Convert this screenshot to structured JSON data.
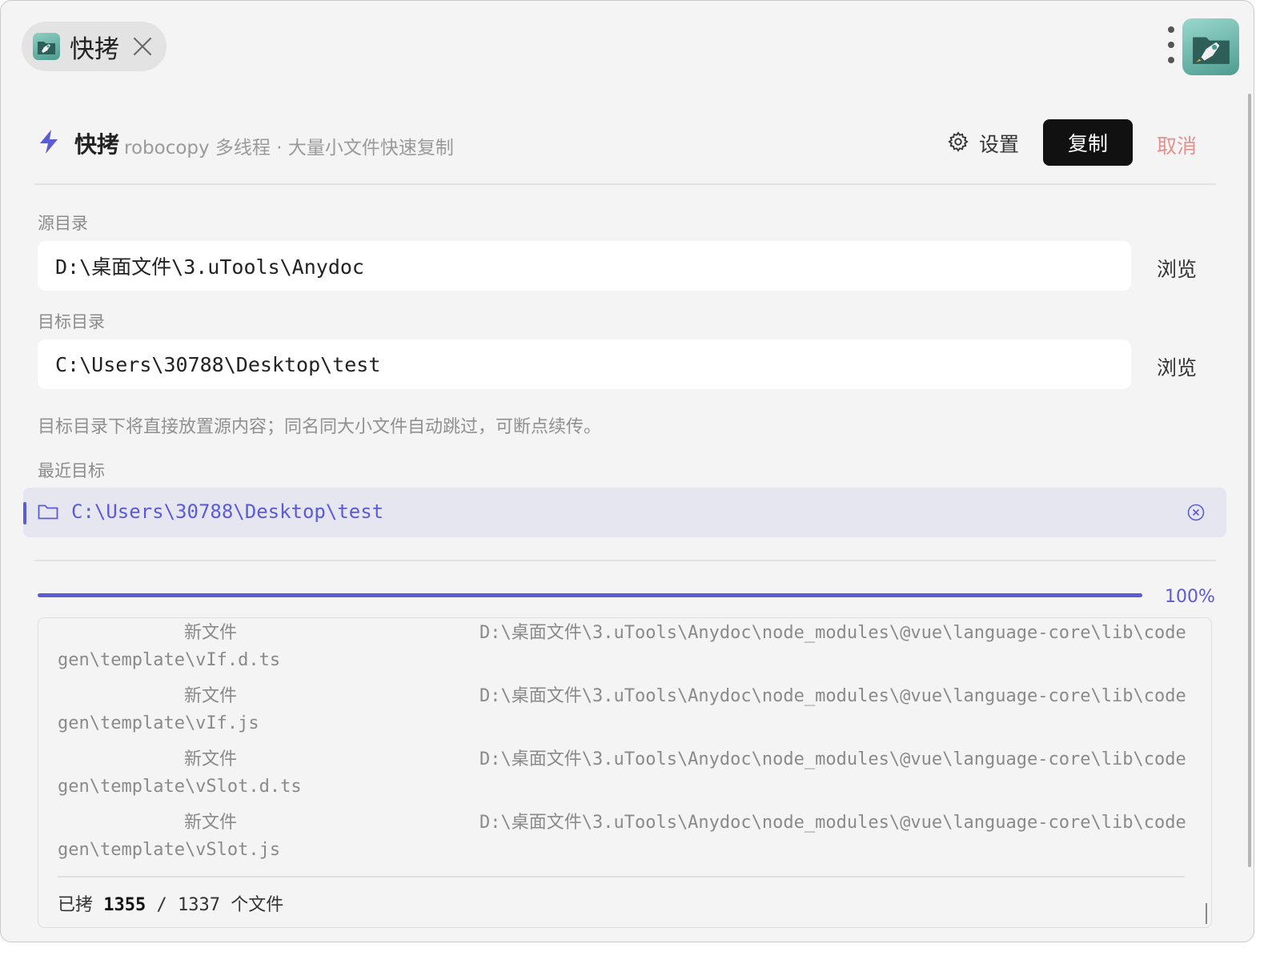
{
  "tab": {
    "title": "快拷"
  },
  "header": {
    "title": "快拷",
    "subtitle": "robocopy 多线程 · 大量小文件快速复制",
    "settings_label": "设置",
    "copy_label": "复制",
    "cancel_label": "取消"
  },
  "source": {
    "label": "源目录",
    "value": "D:\\桌面文件\\3.uTools\\Anydoc",
    "browse_label": "浏览"
  },
  "target": {
    "label": "目标目录",
    "value": "C:\\Users\\30788\\Desktop\\test",
    "browse_label": "浏览"
  },
  "hint": "目标目录下将直接放置源内容；同名同大小文件自动跳过，可断点续传。",
  "recent": {
    "label": "最近目标",
    "items": [
      {
        "path": "C:\\Users\\30788\\Desktop\\test"
      }
    ]
  },
  "progress": {
    "percent": 100,
    "label": "100%"
  },
  "log": {
    "entries": [
      {
        "status": "新文件",
        "path_line1": "D:\\桌面文件\\3.uTools\\Anydoc\\node_modules\\@vue\\language-core\\lib\\code",
        "path_line2": "gen\\template\\vIf.d.ts"
      },
      {
        "status": "新文件",
        "path_line1": "D:\\桌面文件\\3.uTools\\Anydoc\\node_modules\\@vue\\language-core\\lib\\code",
        "path_line2": "gen\\template\\vIf.js"
      },
      {
        "status": "新文件",
        "path_line1": "D:\\桌面文件\\3.uTools\\Anydoc\\node_modules\\@vue\\language-core\\lib\\code",
        "path_line2": "gen\\template\\vSlot.d.ts"
      },
      {
        "status": "新文件",
        "path_line1": "D:\\桌面文件\\3.uTools\\Anydoc\\node_modules\\@vue\\language-core\\lib\\code",
        "path_line2": "gen\\template\\vSlot.js"
      }
    ],
    "summary": {
      "prefix": "已拷",
      "copied": "1355",
      "separator": "/",
      "total": "1337",
      "suffix": "个文件"
    }
  },
  "colors": {
    "accent": "#5b5bd6",
    "cancel": "#e4928e",
    "primary_button": "#111111"
  },
  "icons": {
    "tab": "rocket-folder-icon",
    "logo": "rocket-folder-icon",
    "header": "lightning-icon",
    "settings": "gear-icon",
    "recent": "folder-icon",
    "remove": "close-circle-icon",
    "menu": "more-vertical-icon",
    "close": "close-icon"
  }
}
